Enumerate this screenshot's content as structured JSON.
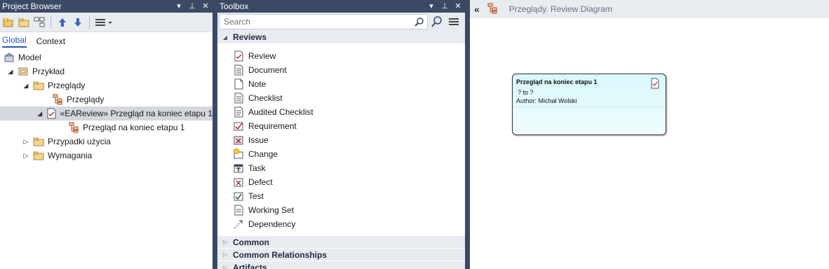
{
  "project_browser": {
    "title": "Project Browser",
    "tabs": [
      "Global",
      "Context"
    ],
    "tree": [
      {
        "label": "Model",
        "icon": "model-root-icon",
        "toggle": "",
        "indent": 0
      },
      {
        "label": "Przykład",
        "icon": "package-view-icon",
        "toggle": "◢",
        "indent": 1
      },
      {
        "label": "Przeglądy",
        "icon": "folder-icon",
        "toggle": "◢",
        "indent": 2
      },
      {
        "label": "Przeglądy",
        "icon": "diagram-icon",
        "toggle": "",
        "indent": 3
      },
      {
        "label": "«EAReview» Przegląd na koniec etapu 1",
        "icon": "review-icon",
        "toggle": "◢",
        "indent": 3
      },
      {
        "label": "Przegląd na koniec etapu 1",
        "icon": "diagram-icon",
        "toggle": "",
        "indent": 4
      },
      {
        "label": "Przypadki użycia",
        "icon": "folder-icon",
        "toggle": "▷",
        "indent": 2
      },
      {
        "label": "Wymagania",
        "icon": "folder-icon",
        "toggle": "▷",
        "indent": 2
      }
    ]
  },
  "toolbox": {
    "title": "Toolbox",
    "search_placeholder": "Search",
    "open_section": "Reviews",
    "items": [
      {
        "label": "Review",
        "icon": "review-icon"
      },
      {
        "label": "Document",
        "icon": "document-icon"
      },
      {
        "label": "Note",
        "icon": "note-icon"
      },
      {
        "label": "Checklist",
        "icon": "checklist-icon"
      },
      {
        "label": "Audited Checklist",
        "icon": "audited-checklist-icon"
      },
      {
        "label": "Requirement",
        "icon": "requirement-icon"
      },
      {
        "label": "Issue",
        "icon": "issue-icon"
      },
      {
        "label": "Change",
        "icon": "change-icon"
      },
      {
        "label": "Task",
        "icon": "task-icon"
      },
      {
        "label": "Defect",
        "icon": "defect-icon"
      },
      {
        "label": "Test",
        "icon": "test-icon"
      },
      {
        "label": "Working Set",
        "icon": "working-set-icon"
      },
      {
        "label": "Dependency",
        "icon": "dependency-icon"
      }
    ],
    "closed_sections": [
      "Common",
      "Common Relationships",
      "Artifacts"
    ]
  },
  "diagram": {
    "breadcrumb": "Przeglądy.  Review Diagram",
    "element": {
      "title": "Przegląd na koniec etapu 1",
      "line1": "? to ?",
      "line2": "Author: Michał Wolski"
    }
  },
  "colors": {
    "titlebar": "#3b4a64",
    "selection": "#d4d7de",
    "element_fill": "#e6fbfd",
    "accent": "#1e5aa8"
  }
}
